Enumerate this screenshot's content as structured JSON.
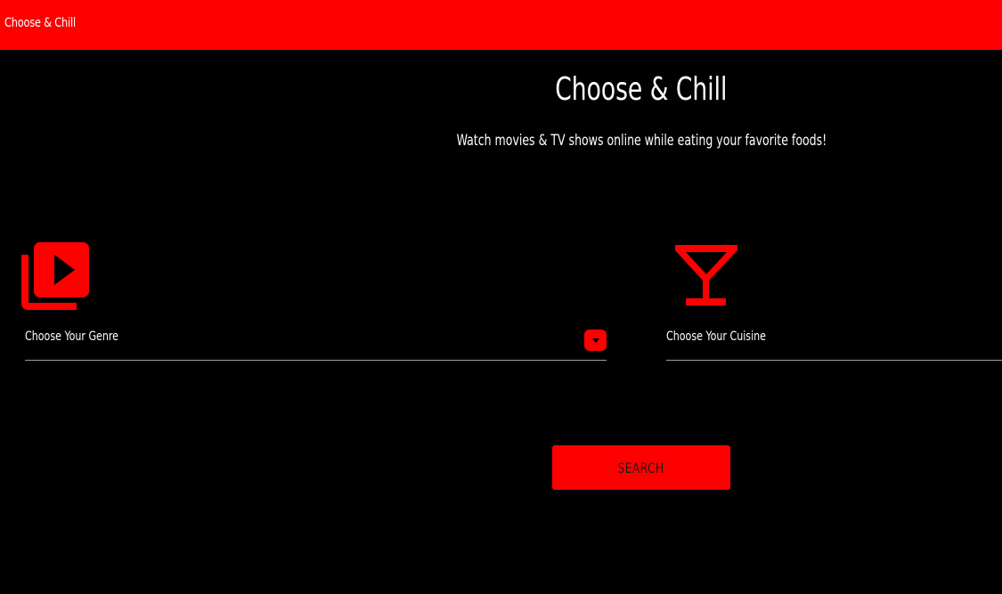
{
  "navbar": {
    "brand": "Choose & Chill",
    "background": "#ff0000"
  },
  "hero": {
    "title": "Choose & Chill",
    "subtitle": "Watch movies & TV shows online while eating your favorite foods!"
  },
  "genre": {
    "icon": "video-library-icon",
    "label": "Choose Your Genre",
    "dropdown_icon": "caret-down-icon"
  },
  "cuisine": {
    "icon": "cocktail-glass-icon",
    "label": "Choose Your Cuisine"
  },
  "search_button": {
    "label": "SEARCH"
  },
  "colors": {
    "accent": "#ff0000",
    "background": "#000000",
    "text": "#ffffff",
    "underline": "#9e9e9e"
  }
}
